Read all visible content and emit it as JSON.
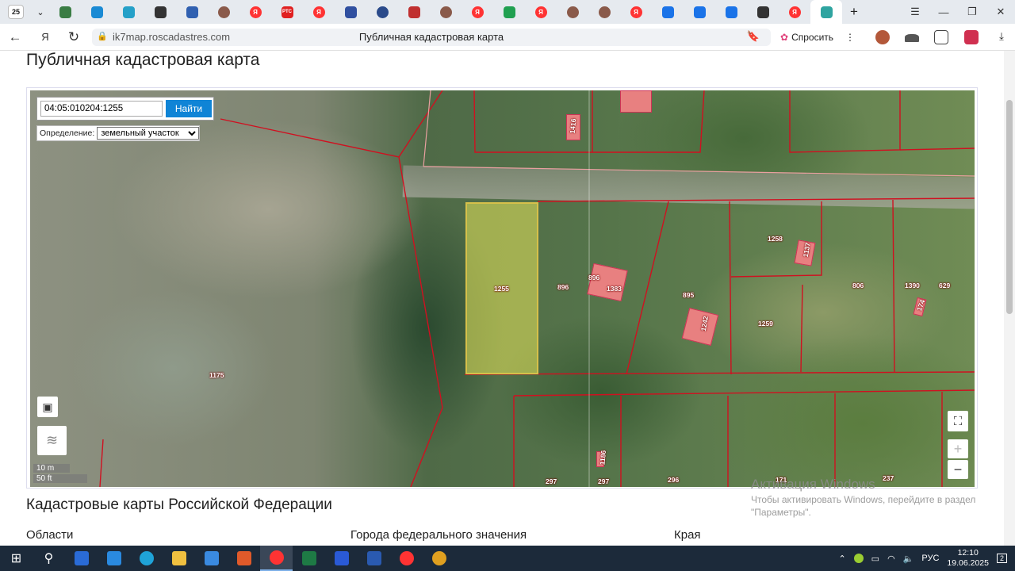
{
  "browser": {
    "tab_count": "25",
    "tabs": [
      {
        "icon": "mountain-icon",
        "color": "#3a7d44"
      },
      {
        "icon": "edge-icon",
        "color": "#1a8ad4"
      },
      {
        "icon": "edge-icon",
        "color": "#24a0c8"
      },
      {
        "icon": "menu-icon",
        "color": "#333333"
      },
      {
        "icon": "globe-icon",
        "color": "#3060b0"
      },
      {
        "icon": "avatar-icon",
        "color": "#8a5a4a"
      },
      {
        "icon": "yandex-icon",
        "color": "#ff3333"
      },
      {
        "icon": "rts-icon",
        "color": "#e02020",
        "text": "РТС"
      },
      {
        "icon": "yandex-icon",
        "color": "#ff3333"
      },
      {
        "icon": "emblem-icon",
        "color": "#3050a0"
      },
      {
        "icon": "ring-icon",
        "color": "#2a4a8a"
      },
      {
        "icon": "flag-icon",
        "color": "#c03030"
      },
      {
        "icon": "avatar-icon",
        "color": "#8a5a4a"
      },
      {
        "icon": "yandex-icon",
        "color": "#ff3333"
      },
      {
        "icon": "map-icon",
        "color": "#20a050"
      },
      {
        "icon": "yandex-icon",
        "color": "#ff3333"
      },
      {
        "icon": "avatar-icon",
        "color": "#8a5a4a"
      },
      {
        "icon": "avatar-icon",
        "color": "#8a5a4a"
      },
      {
        "icon": "yandex-icon",
        "color": "#ff3333"
      },
      {
        "icon": "mail-icon",
        "color": "#1a73e8"
      },
      {
        "icon": "mail-icon",
        "color": "#1a73e8"
      },
      {
        "icon": "mail-icon",
        "color": "#1a73e8"
      },
      {
        "icon": "pen-icon",
        "color": "#333333"
      },
      {
        "icon": "yandex-icon",
        "color": "#ff3333"
      },
      {
        "icon": "cadastre-icon",
        "color": "#2fa4a0"
      }
    ],
    "url": "ik7map.roscadastres.com",
    "page_title": "Публичная кадастровая карта",
    "ask_label": "Спросить"
  },
  "page": {
    "heading": "Публичная кадастровая карта",
    "search": {
      "value": "04:05:010204:1255",
      "button": "Найти"
    },
    "definition": {
      "label": "Определение:",
      "selected": "земельный участок"
    },
    "scale": {
      "metric": "10 m",
      "imperial": "50 ft"
    },
    "parcel_labels": [
      "1255",
      "896",
      "896",
      "1383",
      "895",
      "1242",
      "1258",
      "1137",
      "1259",
      "806",
      "1390",
      "629",
      "174",
      "1175",
      "1416",
      "1186",
      "297",
      "297",
      "296",
      "171",
      "237"
    ],
    "section_heading": "Кадастровые карты Российской Федерации",
    "columns": [
      "Области",
      "Города федерального значения",
      "Края"
    ]
  },
  "watermark": {
    "line1": "Активация Windows",
    "line2": "Чтобы активировать Windows, перейдите в раздел",
    "line3": "\"Параметры\"."
  },
  "taskbar": {
    "language": "РУС",
    "time": "12:10",
    "date": "19.06.2025",
    "notifications": "2",
    "apps": [
      {
        "icon": "file-explorer-blue-icon",
        "color": "#2a6bd6"
      },
      {
        "icon": "store-icon",
        "color": "#2a8ae0"
      },
      {
        "icon": "edge-icon",
        "color": "#1fa3d8"
      },
      {
        "icon": "folder-icon",
        "color": "#f0c040"
      },
      {
        "icon": "mail-icon",
        "color": "#3a8ae0"
      },
      {
        "icon": "office-icon",
        "color": "#e05a2a"
      },
      {
        "icon": "yandex-browser-icon",
        "color": "#ff3333"
      },
      {
        "icon": "excel-icon",
        "color": "#1e7a45"
      },
      {
        "icon": "yandex-y-icon",
        "color": "#2a5ad6"
      },
      {
        "icon": "word-icon",
        "color": "#2a5ab0"
      },
      {
        "icon": "yandex-icon",
        "color": "#ff3333"
      },
      {
        "icon": "chrome-icon",
        "color": "#e0a020"
      }
    ]
  }
}
